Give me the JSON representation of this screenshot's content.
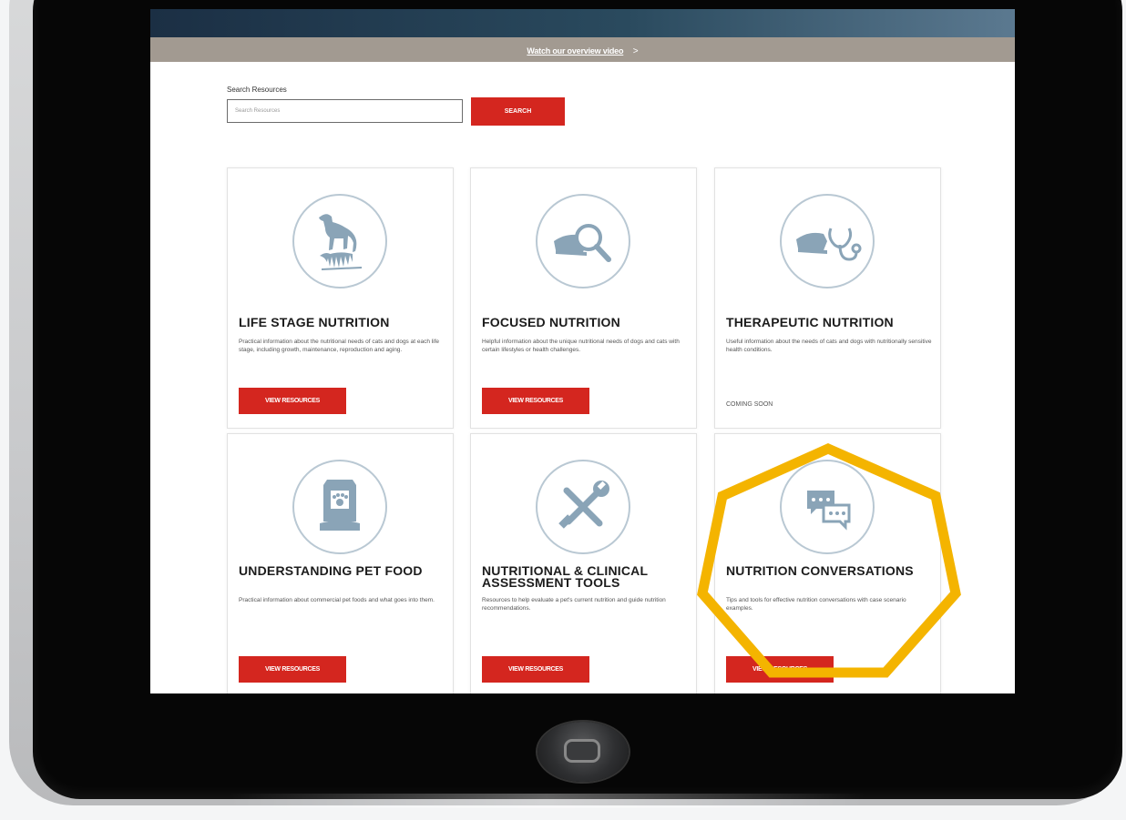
{
  "header": {
    "video_link": "Watch our overview video",
    "video_chevron": ">"
  },
  "search": {
    "label": "Search Resources",
    "placeholder": "Search Resources",
    "button_label": "SEARCH"
  },
  "cards": [
    {
      "title": "LIFE STAGE NUTRITION",
      "description": "Practical information about the nutritional needs of cats and dogs at each life stage, including growth, maintenance, reproduction and aging.",
      "button": "VIEW RESOURCES",
      "icon": "dog-icon"
    },
    {
      "title": "FOCUSED NUTRITION",
      "description": "Helpful information about the unique nutritional needs of dogs and cats with certain lifestyles or health challenges.",
      "button": "VIEW RESOURCES",
      "icon": "food-bowl-magnifier-icon"
    },
    {
      "title": "THERAPEUTIC NUTRITION",
      "description": "Useful information about the needs of cats and dogs with nutritionally sensitive health conditions.",
      "status": "COMING SOON",
      "icon": "food-bowl-stethoscope-icon"
    },
    {
      "title": "UNDERSTANDING PET FOOD",
      "description": "Practical information about commercial pet foods and what goes into them.",
      "button": "VIEW RESOURCES",
      "icon": "pet-food-bag-icon"
    },
    {
      "title": "NUTRITIONAL & CLINICAL ASSESSMENT TOOLS",
      "description": "Resources to help evaluate a pet's current nutrition and guide nutrition recommendations.",
      "button": "VIEW RESOURCES",
      "icon": "wrench-screwdriver-icon"
    },
    {
      "title": "NUTRITION CONVERSATIONS",
      "description": "Tips and tools for effective nutrition conversations with case scenario examples.",
      "button": "VIEW RESOURCES",
      "icon": "chat-bubbles-icon"
    }
  ],
  "colors": {
    "accent_red": "#d4261f",
    "icon_blue": "#8aa4b7",
    "highlight": "#f4b400",
    "video_bar": "#a29a91"
  }
}
